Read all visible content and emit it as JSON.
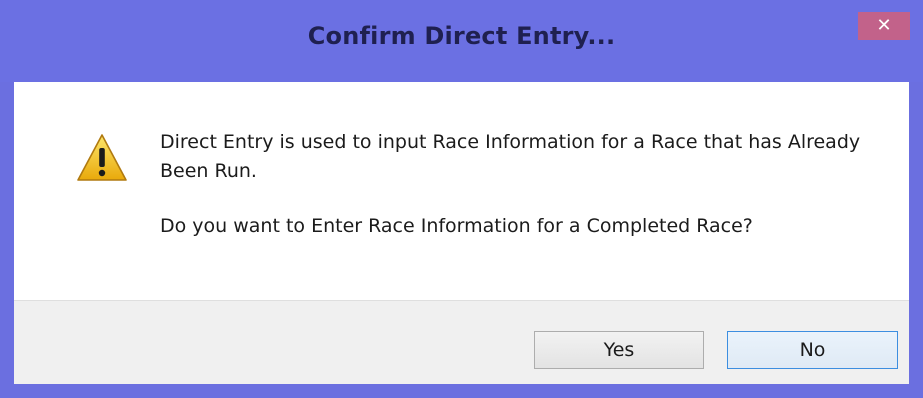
{
  "window": {
    "title": "Confirm Direct Entry...",
    "close_glyph": "✕"
  },
  "message": {
    "line1": "Direct Entry is used to input Race Information for a Race that has Already Been Run.",
    "question": "Do you want to Enter Race Information for a Completed Race?",
    "icon": "warning-icon"
  },
  "buttons": {
    "yes": "Yes",
    "no": "No"
  },
  "colors": {
    "titlebar": "#6b70e3",
    "close": "#c2628a",
    "default_button_border": "#3c8ee0"
  }
}
